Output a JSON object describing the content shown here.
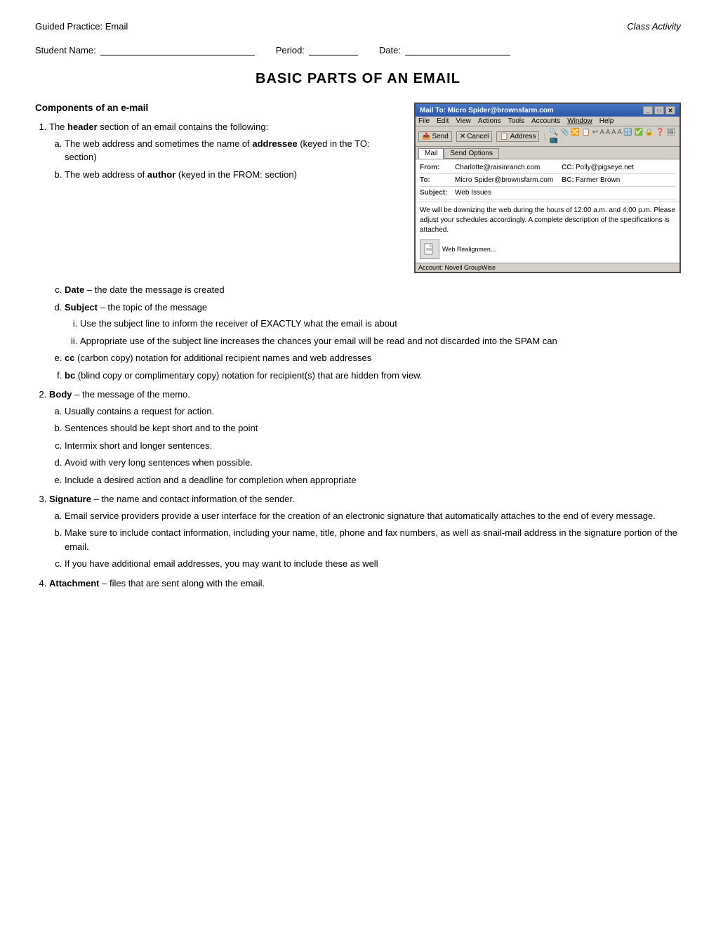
{
  "header": {
    "left": "Guided Practice:  Email",
    "right": "Class Activity"
  },
  "student_line": {
    "name_label": "Student Name:",
    "period_label": "Period:",
    "date_label": "Date:"
  },
  "title": "Basic Parts of an Email",
  "section_components_title": "Components of an e-mail",
  "items": [
    {
      "number": "1",
      "intro": "The ",
      "bold_intro": "header",
      "intro2": " section of an email contains the following:",
      "sub_items": [
        {
          "letter": "a",
          "text_parts": [
            "The web address and sometimes the name of ",
            "addressee",
            " (keyed in the TO: section)"
          ]
        },
        {
          "letter": "b",
          "text_parts": [
            "The web address of ",
            "author",
            " (keyed in the FROM: section)"
          ]
        },
        {
          "letter": "c",
          "bold": "Date",
          "text": " – the date the message is created"
        },
        {
          "letter": "d",
          "bold": "Subject",
          "text": " – the topic of the message",
          "roman_items": [
            "Use the subject line to inform the receiver of EXACTLY what the email is about",
            "Appropriate use of the subject line increases the chances your email will be read and not discarded into the SPAM can"
          ]
        },
        {
          "letter": "e",
          "bold": "cc",
          "text": " (carbon copy) notation for additional recipient names and web addresses"
        },
        {
          "letter": "f",
          "bold": "bc",
          "text": " (blind copy or complimentary copy) notation for recipient(s) that are hidden from view."
        }
      ]
    },
    {
      "number": "2",
      "bold": "Body",
      "text": " – the message of the memo.",
      "sub_items": [
        {
          "letter": "a",
          "text": "Usually contains a request for action."
        },
        {
          "letter": "b",
          "text": "Sentences should be kept short and to the point"
        },
        {
          "letter": "c",
          "text": "Intermix short and longer sentences."
        },
        {
          "letter": "d",
          "text": "Avoid with very long sentences when possible."
        },
        {
          "letter": "e",
          "text": "Include a desired action and a deadline for completion when appropriate"
        }
      ]
    },
    {
      "number": "3",
      "bold": "Signature",
      "text": " – the name and contact information of the sender.",
      "sub_items": [
        {
          "letter": "a",
          "text": "Email service providers provide a user interface for the creation of an electronic signature that automatically attaches to the end of every message."
        },
        {
          "letter": "b",
          "text": "Make sure to include contact information, including your name, title, phone and fax numbers, as well as snail-mail address in the signature portion of the email."
        },
        {
          "letter": "c",
          "text": "If you have additional email addresses, you may want to include these as well"
        }
      ]
    },
    {
      "number": "4",
      "bold": "Attachment",
      "text": " – files that are sent along with the email."
    }
  ],
  "email_screenshot": {
    "titlebar": "Mail To: Micro Spider@brownsfarm.com",
    "menu_items": [
      "File",
      "Edit",
      "View",
      "Actions",
      "Tools",
      "Accounts",
      "Window",
      "Help"
    ],
    "toolbar_buttons": [
      "Send",
      "Cancel",
      "Address"
    ],
    "tabs": [
      "Mail",
      "Send Options"
    ],
    "from_value": "Charlotte@raisinranch.com",
    "to_value": "Micro Spider@brownsfarm.com",
    "cc_value": "Polly@pigseye.net",
    "bc_value": "Farmer Brown",
    "subject_value": "Web Issues",
    "body_text": "We will be downizing the web during the hours of 12:00 a.m. and 4:00 p.m. Please adjust your schedules accordingly.  A complete description of the specifications is attached.",
    "attachment_label": "Web Realignmen...",
    "status_bar": "Account: Novell GroupWise"
  }
}
